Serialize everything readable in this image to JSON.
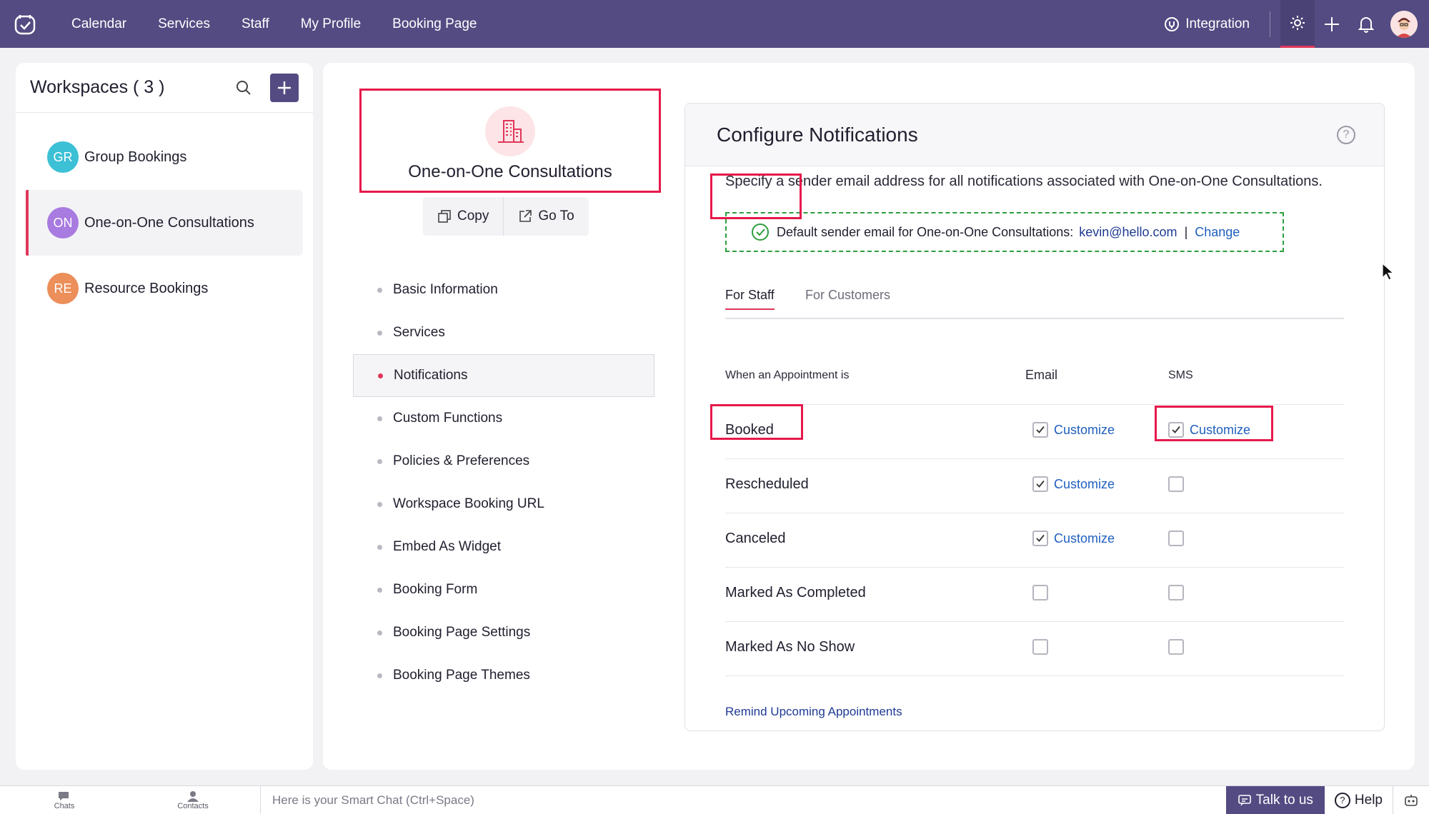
{
  "topnav": {
    "items": [
      "Calendar",
      "Services",
      "Staff",
      "My Profile",
      "Booking Page"
    ],
    "integration_label": "Integration"
  },
  "workspaces": {
    "title": "Workspaces ( 3 )",
    "items": [
      {
        "initials": "GR",
        "name": "Group Bookings",
        "color": "#3cc0d6"
      },
      {
        "initials": "ON",
        "name": "One-on-One Consultations",
        "color": "#a87be0"
      },
      {
        "initials": "RE",
        "name": "Resource Bookings",
        "color": "#ec8f5a"
      }
    ]
  },
  "workspace_card": {
    "title": "One-on-One Consultations",
    "copy_label": "Copy",
    "goto_label": "Go To"
  },
  "menu": {
    "items": [
      "Basic Information",
      "Services",
      "Notifications",
      "Custom Functions",
      "Policies & Preferences",
      "Workspace Booking URL",
      "Embed As Widget",
      "Booking Form",
      "Booking Page Settings",
      "Booking Page Themes"
    ]
  },
  "configure": {
    "title": "Configure Notifications",
    "help": "?",
    "description": "Specify a sender email address for all notifications associated with One-on-One Consultations.",
    "sender_prefix": "Default sender email for One-on-One Consultations:",
    "sender_email": "kevin@hello.com",
    "pipe": "|",
    "change_label": "Change",
    "tabs": [
      "For Staff",
      "For Customers"
    ],
    "table": {
      "col_event": "When an Appointment is",
      "col_email": "Email",
      "col_sms": "SMS",
      "customize_label": "Customize",
      "rows": [
        {
          "label": "Booked",
          "email": true,
          "sms": true
        },
        {
          "label": "Rescheduled",
          "email": true,
          "sms": false
        },
        {
          "label": "Canceled",
          "email": true,
          "sms": false
        },
        {
          "label": "Marked As Completed",
          "email": false,
          "sms": false
        },
        {
          "label": "Marked As No Show",
          "email": false,
          "sms": false
        }
      ]
    },
    "remind_label": "Remind Upcoming Appointments"
  },
  "bottombar": {
    "chats": "Chats",
    "contacts": "Contacts",
    "smart_chat_placeholder": "Here is your Smart Chat (Ctrl+Space)",
    "talk": "Talk to us",
    "help": "Help"
  },
  "colors": {
    "topbar": "#544b82",
    "accent": "#e0375a",
    "highlight": "#e6194b",
    "link": "#1f5fbf"
  }
}
